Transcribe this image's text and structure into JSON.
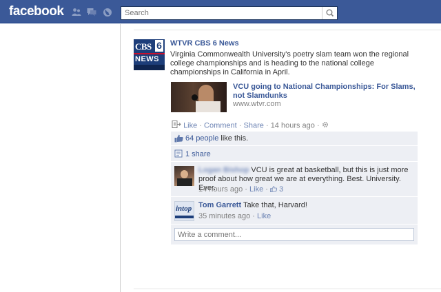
{
  "header": {
    "logo": "facebook",
    "search": {
      "placeholder": "Search"
    }
  },
  "post": {
    "author": "WTVR CBS 6 News",
    "page_logo": {
      "line1": "CBS",
      "digit": "6",
      "line2": "NEWS"
    },
    "message": "Virginia Commonwealth University's poetry slam team won the regional college championships and is heading to the national college championships in California in April.",
    "attachment": {
      "title": "VCU going to National Championships: For Slams, not Slamdunks",
      "source": "www.wtvr.com"
    },
    "actions": {
      "like": "Like",
      "comment": "Comment",
      "share": "Share",
      "time": "14 hours ago",
      "separator": "·"
    }
  },
  "ufi": {
    "likes": {
      "count_text": "64 people",
      "suffix": " like this."
    },
    "shares": {
      "text": "1 share"
    },
    "comments": [
      {
        "author": "Logan Bishop",
        "text": "VCU is great at basketball, but this is just more proof about how great we are at everything. Best. University. Ever.",
        "time": "14 hours ago",
        "like_label": "Like",
        "like_count": "3"
      },
      {
        "author": "Tom Garrett",
        "text": "Take that, Harvard!",
        "time": "35 minutes ago",
        "like_label": "Like"
      }
    ],
    "write_placeholder": "Write a comment..."
  },
  "colors": {
    "brand_blue": "#3b5998",
    "link_blue": "#3b5998",
    "muted_link": "#6d84b4",
    "ufi_bg": "#edeff4"
  },
  "icons": [
    "friend-requests-icon",
    "messages-icon",
    "notifications-globe-icon",
    "search-icon",
    "like-thumb-icon",
    "share-icon",
    "gear-icon",
    "send-to-mobile-icon"
  ]
}
